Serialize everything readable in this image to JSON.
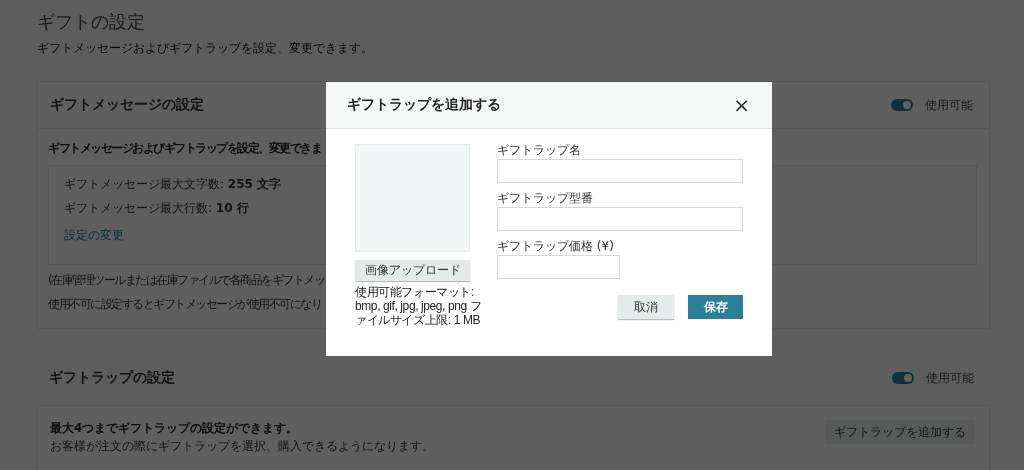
{
  "page": {
    "title": "ギフトの設定",
    "subtitle": "ギフトメッセージおよびギフトラップを設定、変更できます。"
  },
  "gift_message_section": {
    "title": "ギフトメッセージの設定",
    "toggle": {
      "on": true,
      "label": "使用可能"
    },
    "intro": "ギフトメッセージおよびギフトラップを設定、変更できま",
    "details": [
      "ギフトメッセージ最大文字数: **255 文字**",
      "ギフトメッセージ最大行数: **10 行**"
    ],
    "link": "設定の変更",
    "notes": [
      "(在庫管理ツールまたは在庫ファイルで各商品をギフトメッ",
      "使用不可に設定するとギフトメッセージが使用不可になり"
    ]
  },
  "gift_wrap_section": {
    "title": "ギフトラップの設定",
    "toggle": {
      "on": true,
      "label": "使用可能"
    },
    "intro": "最大4つまでギフトラップの設定ができます。",
    "description": "お客様が注文の際にギフトラップを選択、購入できるようになります。",
    "add_button": "ギフトラップを追加する"
  },
  "dialog": {
    "title": "ギフトラップを追加する",
    "close": "×",
    "upload_button": "画像アップロード",
    "format_note": [
      "使用可能フォーマット:",
      "bmp, gif, jpg, jpeg, png フ",
      "ァイルサイズ上限: 1 MB"
    ],
    "fields": [
      {
        "label": "ギフトラップ名",
        "kind": "wide"
      },
      {
        "label": "ギフトラップ型番",
        "kind": "wide"
      },
      {
        "label": "ギフトラップ価格 (¥)",
        "kind": "narrow"
      }
    ],
    "cancel_button": "取消",
    "save_button": "保存"
  }
}
